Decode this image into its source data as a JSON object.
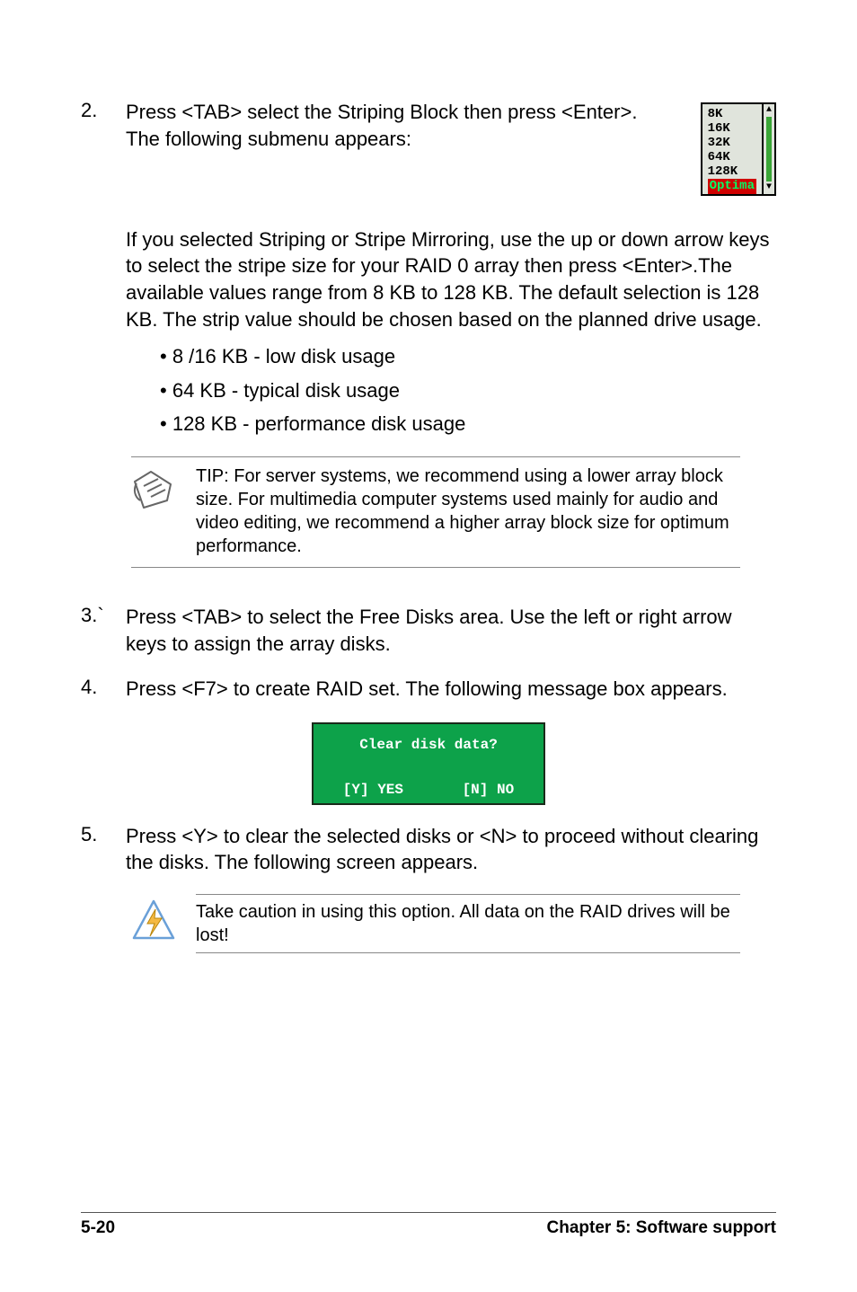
{
  "step2": {
    "number": "2.",
    "text": "Press <TAB> select the Striping Block then press <Enter>. The following submenu appears:",
    "menu": [
      "8K",
      "16K",
      "32K",
      "64K",
      "128K"
    ],
    "menu_selected": "Optima"
  },
  "stripe_paragraph": "If you selected Striping or Stripe Mirroring, use the up or down arrow keys to select the stripe size for your RAID 0 array then press <Enter>.The available values range from 8 KB to 128 KB. The default selection is 128 KB. The strip value should be chosen based on the planned drive usage.",
  "bullets": [
    "8 /16 KB - low disk usage",
    "64 KB - typical disk usage",
    "128 KB - performance disk usage"
  ],
  "tip": "TIP: For server systems, we recommend using a lower array block size. For multimedia computer systems used mainly for audio and video editing, we recommend a higher array block size for optimum performance.",
  "step3": {
    "number": "3.`",
    "text": "Press <TAB> to select the Free Disks area. Use the left or right arrow keys to assign the array disks."
  },
  "step4": {
    "number": "4.",
    "text": "Press <F7> to create RAID set. The following message box appears."
  },
  "dialog": {
    "title": "Clear disk data?",
    "yes": "[Y] YES",
    "no": "[N] NO"
  },
  "step5": {
    "number": "5.",
    "text": "Press <Y> to clear the selected disks or <N> to proceed without clearing the disks. The following screen appears."
  },
  "caution": "Take caution in using this option. All data on the RAID drives will be lost!",
  "footer": {
    "page": "5-20",
    "chapter": "Chapter 5: Software support"
  }
}
